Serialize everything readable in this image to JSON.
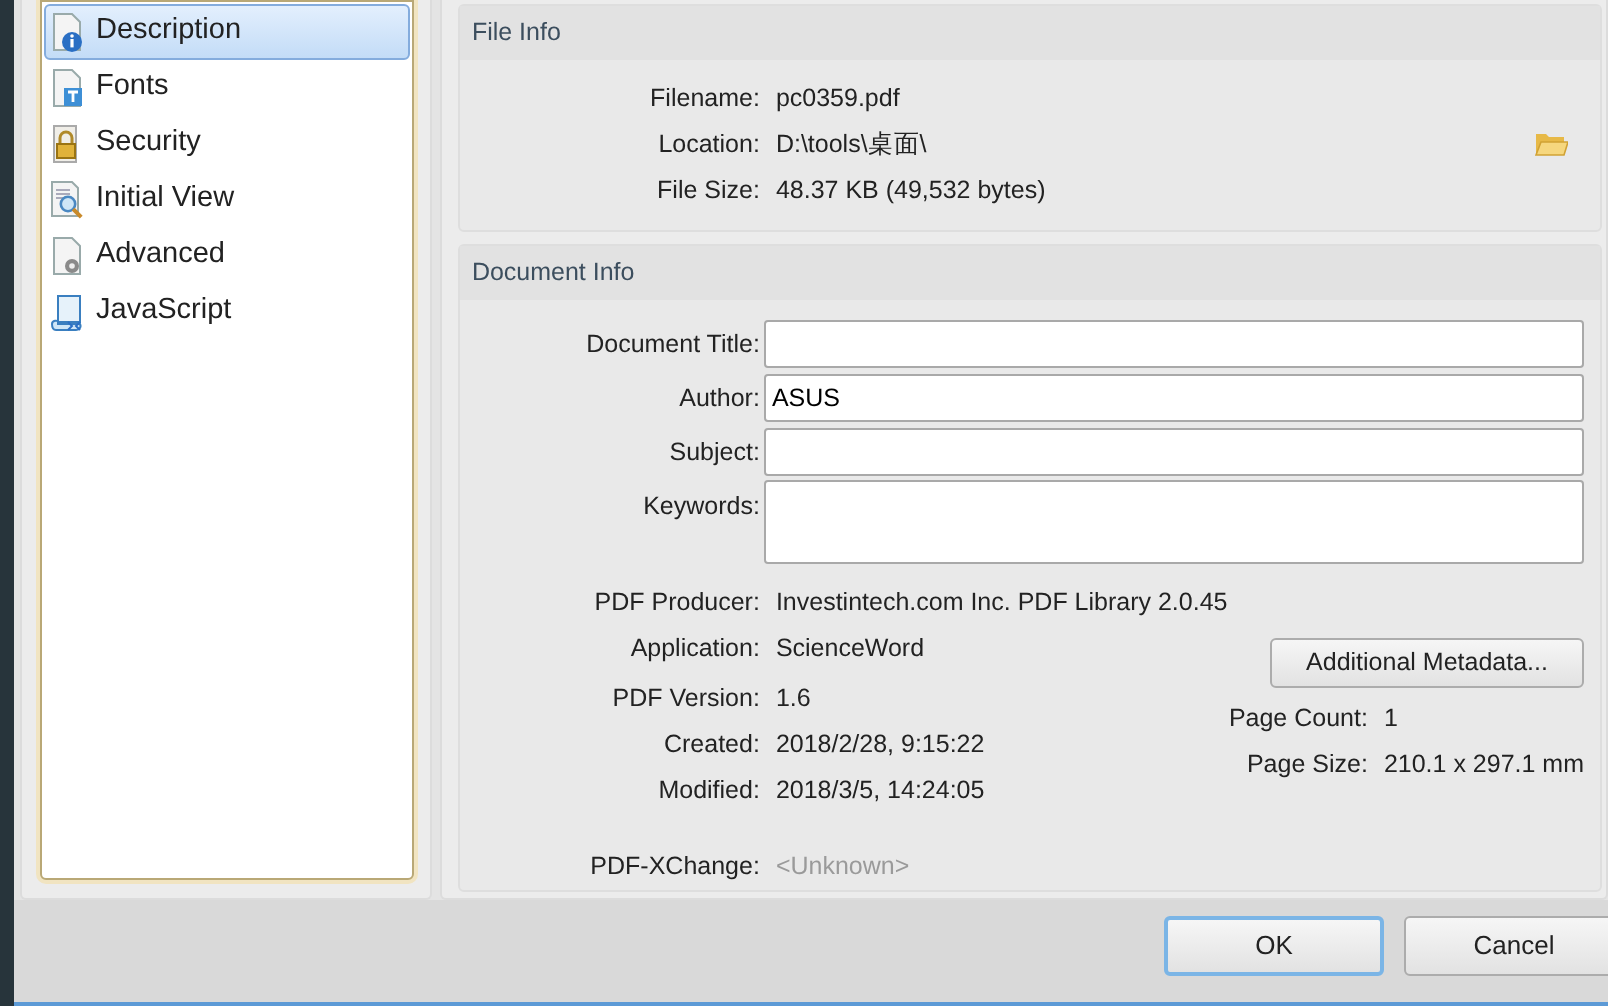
{
  "sidebar": {
    "items": [
      {
        "label": "Description",
        "selected": true
      },
      {
        "label": "Fonts",
        "selected": false
      },
      {
        "label": "Security",
        "selected": false
      },
      {
        "label": "Initial View",
        "selected": false
      },
      {
        "label": "Advanced",
        "selected": false
      },
      {
        "label": "JavaScript",
        "selected": false
      }
    ]
  },
  "file_info": {
    "title": "File Info",
    "rows": [
      {
        "label": "Filename:",
        "value": "pc0359.pdf"
      },
      {
        "label": "Location:",
        "value": "D:\\tools\\桌面\\",
        "browse": true
      },
      {
        "label": "File Size:",
        "value": "48.37 KB (49,532 bytes)"
      }
    ]
  },
  "document_info": {
    "title": "Document Info",
    "fields": [
      {
        "label": "Document Title:",
        "kind": "input"
      },
      {
        "label": "Author:",
        "kind": "input",
        "value": "ASUS"
      },
      {
        "label": "Subject:",
        "kind": "input"
      },
      {
        "label": "Keywords:",
        "kind": "textarea"
      }
    ],
    "properties": [
      {
        "label": "PDF Producer:",
        "value": "Investintech.com Inc. PDF Library 2.0.45",
        "disabled": false
      },
      {
        "label": "Application:",
        "value": "ScienceWord",
        "disabled": false
      }
    ],
    "left_properties": [
      {
        "label": "PDF Version:",
        "value": "1.6",
        "disabled": false
      },
      {
        "label": "Created:",
        "value": "2018/2/28, 9:15:22",
        "disabled": false
      },
      {
        "label": "Modified:",
        "value": "2018/3/5, 14:24:05",
        "disabled": false
      }
    ],
    "metadata_button": "Additional Metadata...",
    "right_properties": [
      {
        "label": "Page Count:",
        "value": "1",
        "disabled": false
      },
      {
        "label": "Page Size:",
        "value": "210.1 x 297.1 mm",
        "disabled": false
      }
    ],
    "extra_properties": [
      {
        "label": "PDF-XChange:",
        "value": "<Unknown>",
        "disabled": true
      }
    ]
  },
  "buttons": [
    {
      "label": "OK",
      "default": true
    },
    {
      "label": "Cancel",
      "default": false
    }
  ]
}
